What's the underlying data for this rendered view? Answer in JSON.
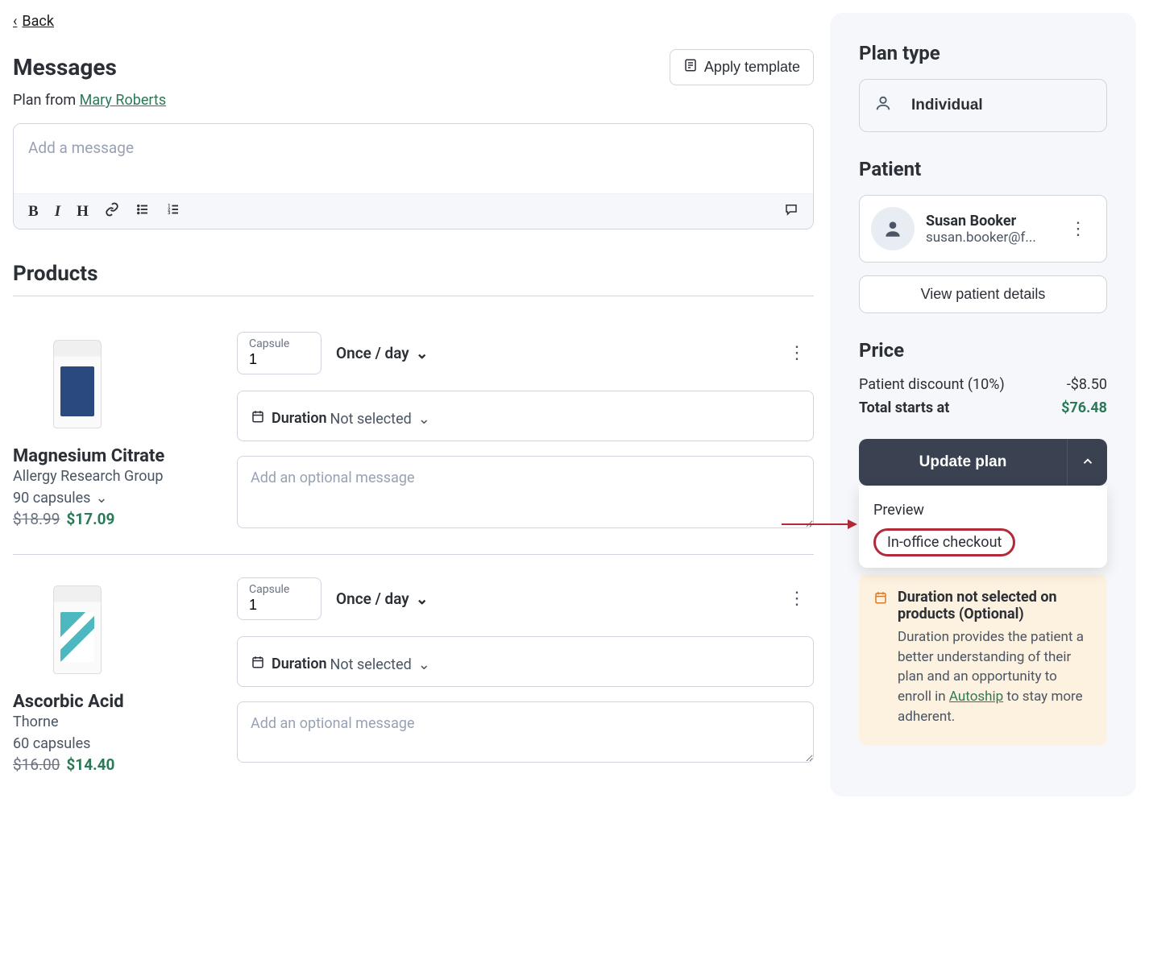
{
  "back_label": "Back",
  "messages": {
    "heading": "Messages",
    "apply_template_label": "Apply template",
    "plan_from_prefix": "Plan from ",
    "plan_from_name": "Mary Roberts",
    "placeholder": "Add a message"
  },
  "products_heading": "Products",
  "products": [
    {
      "name": "Magnesium Citrate",
      "brand": "Allergy Research Group",
      "size": "90 capsules",
      "price_old": "$18.99",
      "price_new": "$17.09",
      "unit_label": "Capsule",
      "unit_value": "1",
      "frequency": "Once / day",
      "duration_heading": "Duration",
      "duration_value": "Not selected",
      "optional_placeholder": "Add an optional message"
    },
    {
      "name": "Ascorbic Acid",
      "brand": "Thorne",
      "size": "60 capsules",
      "price_old": "$16.00",
      "price_new": "$14.40",
      "unit_label": "Capsule",
      "unit_value": "1",
      "frequency": "Once / day",
      "duration_heading": "Duration",
      "duration_value": "Not selected",
      "optional_placeholder": "Add an optional message"
    }
  ],
  "sidebar": {
    "plan_type_heading": "Plan type",
    "plan_type_value": "Individual",
    "patient_heading": "Patient",
    "patient_name": "Susan Booker",
    "patient_email": "susan.booker@f...",
    "view_patient_label": "View patient details",
    "price_heading": "Price",
    "discount_label": "Patient discount (10%)",
    "discount_value": "-$8.50",
    "total_label": "Total starts at",
    "total_value": "$76.48",
    "update_plan_label": "Update plan",
    "dropdown": {
      "preview": "Preview",
      "in_office": "In-office checkout"
    },
    "warning": {
      "title": "Duration not selected on products (Optional)",
      "body_prefix": "Duration provides the patient a better understanding of their plan and an opportunity to enroll in ",
      "autoship": "Autoship",
      "body_suffix": " to stay more adherent."
    }
  }
}
